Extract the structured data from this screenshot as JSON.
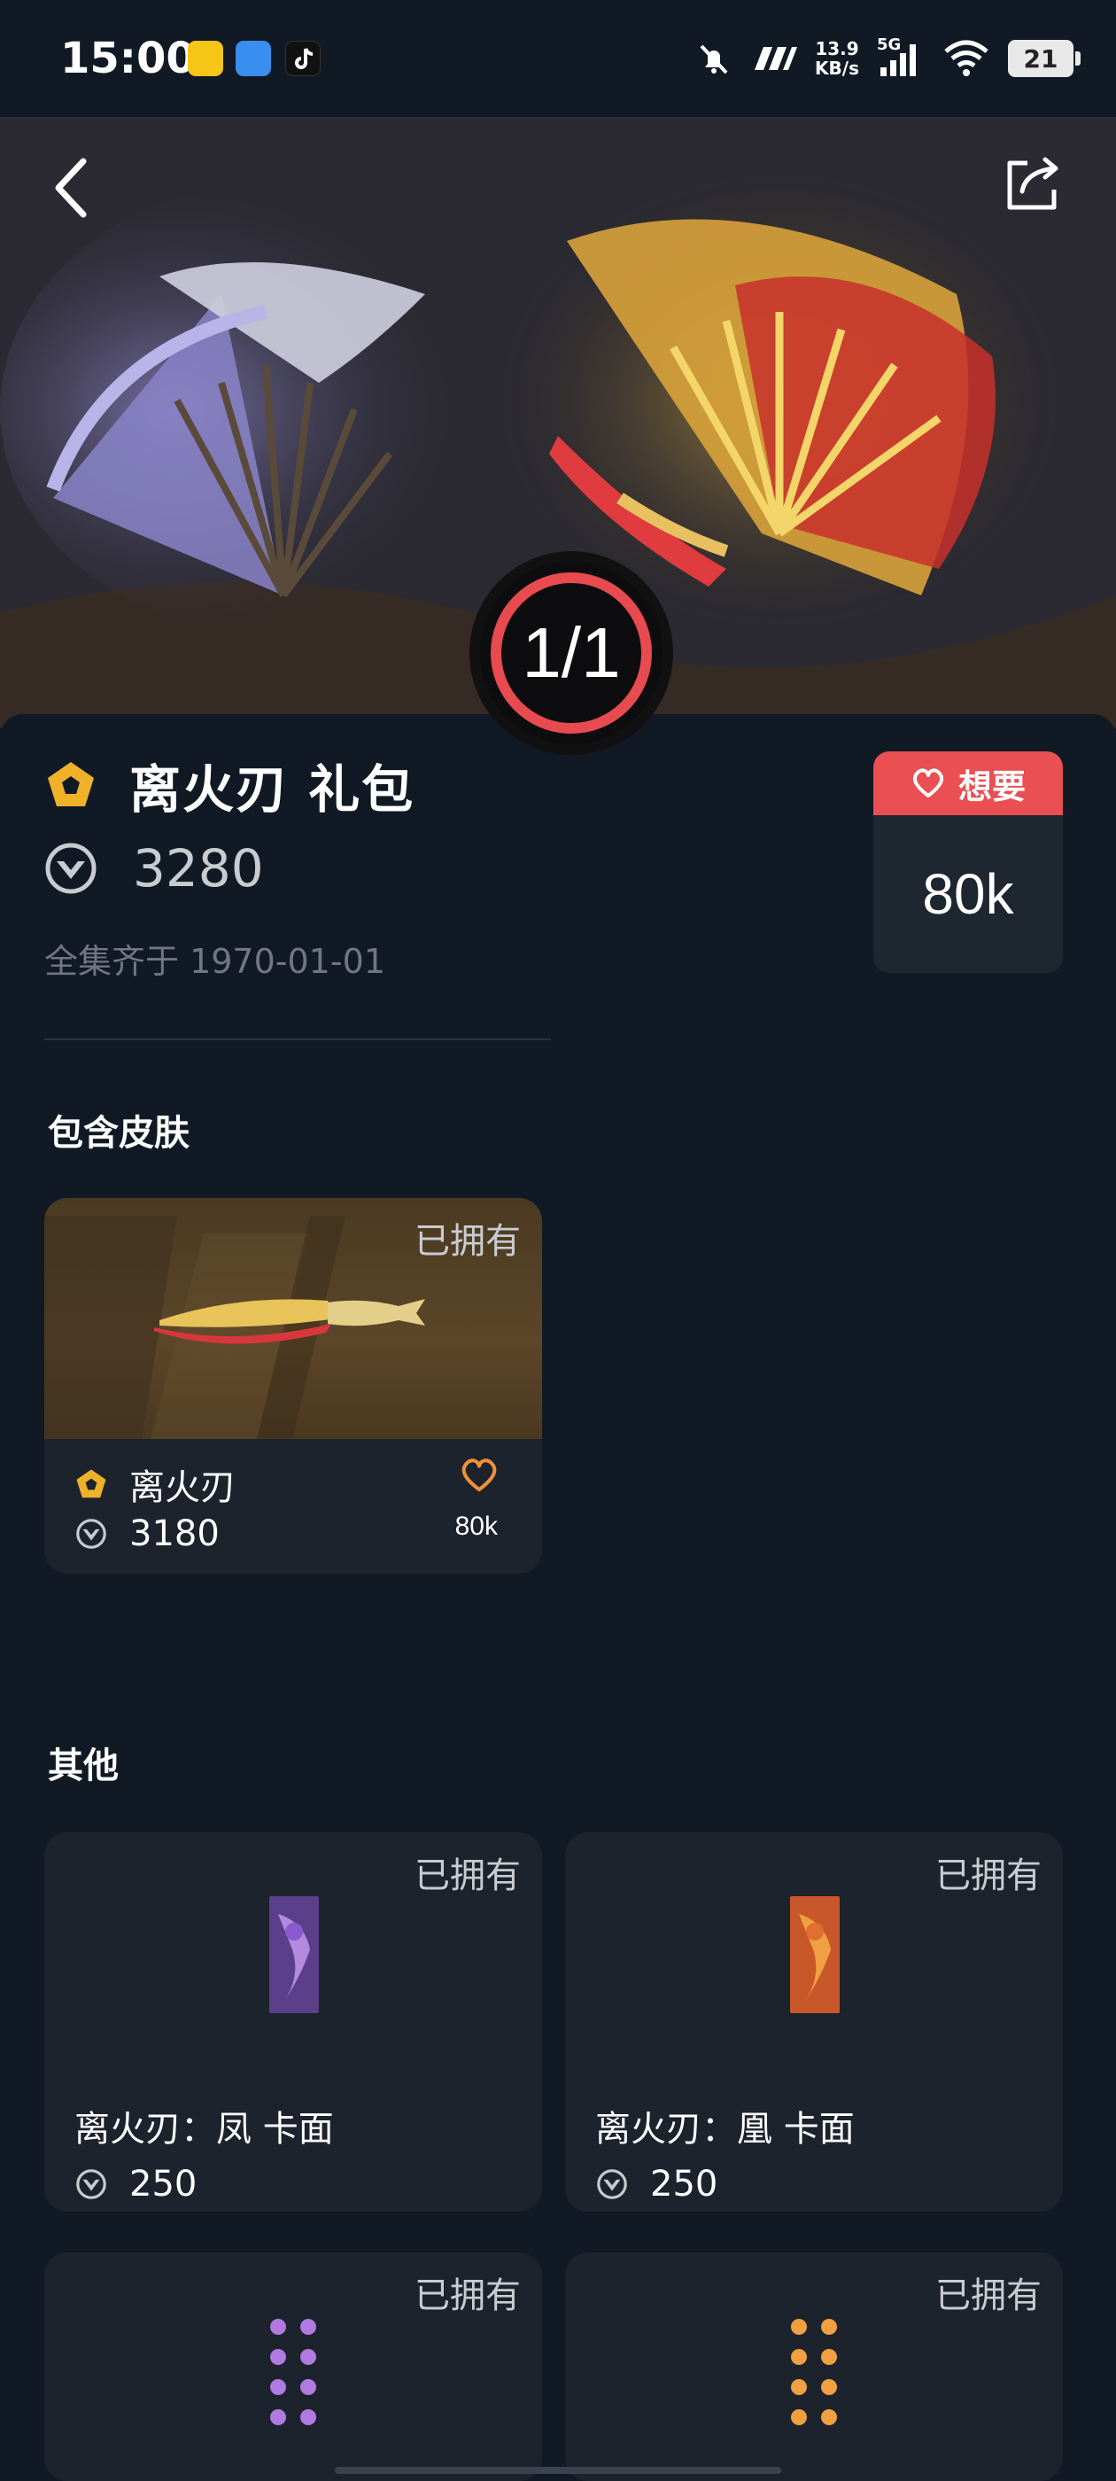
{
  "status_bar": {
    "time": "15:00",
    "net_speed_value": "13.9",
    "net_speed_unit": "KB/s",
    "network": "5G",
    "battery": "21"
  },
  "hero": {
    "counter": "1/1"
  },
  "bundle": {
    "title": "离火刃 礼包",
    "price": "3280",
    "completed_date": "全集齐于 1970-01-01",
    "want_label": "想要",
    "want_count": "80k"
  },
  "sections": {
    "included_skins": "包含皮肤",
    "others": "其他"
  },
  "skin": {
    "owned": "已拥有",
    "name": "离火刃",
    "price": "3180",
    "want_count": "80k"
  },
  "others": [
    {
      "owned": "已拥有",
      "title": "离火刃：凤 卡面",
      "price": "250"
    },
    {
      "owned": "已拥有",
      "title": "离火刃：凰 卡面",
      "price": "250"
    },
    {
      "owned": "已拥有"
    },
    {
      "owned": "已拥有"
    }
  ],
  "colors": {
    "background": "#111a24",
    "card": "#1c232d",
    "accent_red": "#ea4f51",
    "gold": "#f0b12a"
  },
  "icons": [
    "back-icon",
    "share-icon",
    "rank-icon",
    "vp-icon",
    "heart-icon"
  ]
}
